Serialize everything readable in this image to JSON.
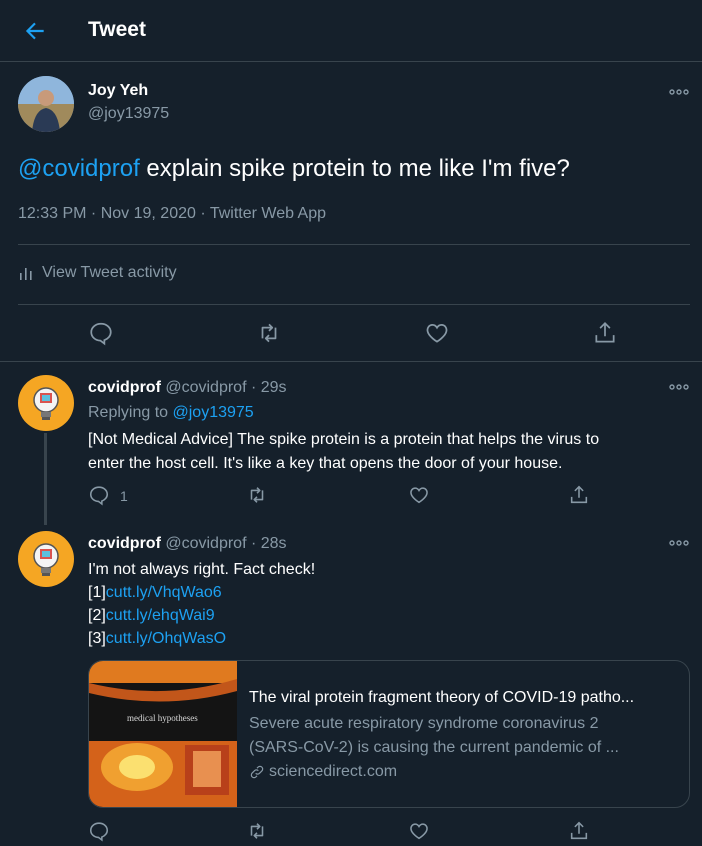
{
  "header": {
    "title": "Tweet"
  },
  "main_tweet": {
    "name": "Joy Yeh",
    "handle": "@joy13975",
    "mention": "@covidprof",
    "text": " explain spike protein to me like I'm five?",
    "meta": "12:33 PM · Nov 19, 2020 · Twitter Web App",
    "activity_label": "View Tweet activity"
  },
  "replies": [
    {
      "name": "covidprof",
      "handle_time": "@covidprof · 29s",
      "replying_prefix": "Replying to ",
      "replying_to": "@joy13975",
      "lines": [
        "[Not Medical Advice] The spike protein is a protein that helps the virus to",
        "enter the host cell. It's like a key that opens the door of your house."
      ],
      "reply_count": "1"
    },
    {
      "name": "covidprof",
      "handle_time": "@covidprof · 28s",
      "text": "I'm not always right. Fact check!",
      "refs": [
        {
          "prefix": "[1]",
          "link": "cutt.ly/VhqWao6"
        },
        {
          "prefix": "[2]",
          "link": "cutt.ly/ehqWai9"
        },
        {
          "prefix": "[3]",
          "link": "cutt.ly/OhqWasO"
        }
      ],
      "card": {
        "image_text": "medical hypotheses",
        "title": "The viral protein fragment theory of COVID-19 patho...",
        "desc_line1": "Severe acute respiratory syndrome coronavirus 2",
        "desc_line2": "(SARS-CoV-2) is causing the current pandemic of ...",
        "domain": "sciencedirect.com"
      }
    }
  ],
  "colors": {
    "background": "#15202b",
    "accent": "#1da1f2",
    "muted": "#8899a6",
    "border": "#38444d"
  }
}
